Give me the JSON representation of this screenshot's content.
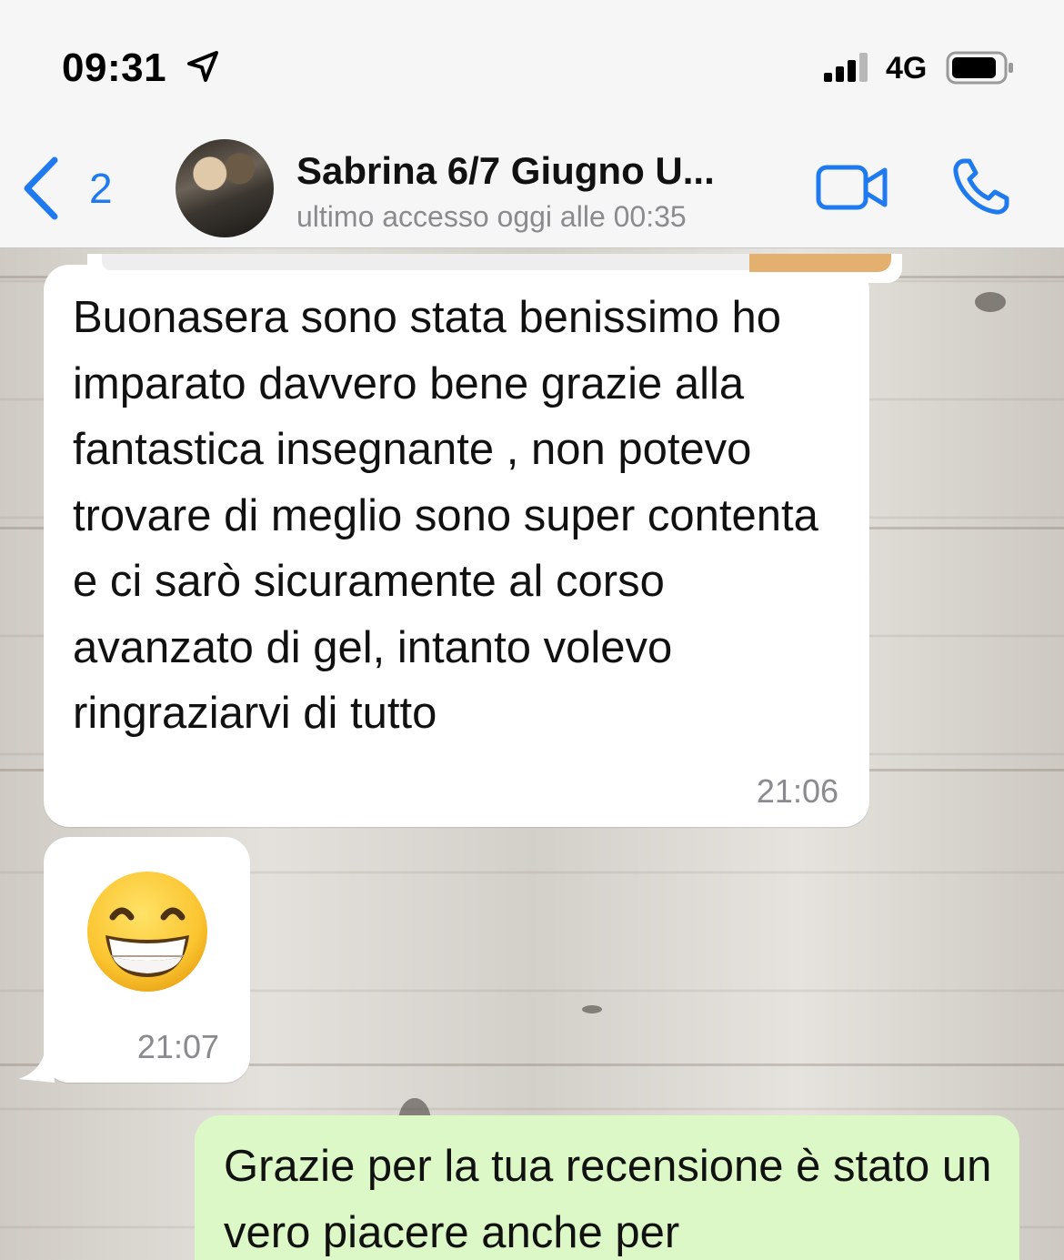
{
  "status_bar": {
    "time": "09:31",
    "network": "4G",
    "icons": [
      "location-arrow-icon",
      "signal-bars-icon",
      "battery-icon"
    ]
  },
  "header": {
    "back_count": "2",
    "contact_name": "Sabrina 6/7 Giugno U...",
    "contact_status": "ultimo accesso oggi alle 00:35",
    "accent_color": "#1f7af0",
    "icons": [
      "chevron-left-icon",
      "video-camera-icon",
      "phone-icon"
    ]
  },
  "messages": [
    {
      "direction": "incoming",
      "text": "Buonasera sono stata benissimo ho imparato davvero bene grazie alla fantastica insegnante , non potevo trovare di meglio sono super contenta e ci sarò sicuramente al corso avanzato di gel, intanto volevo ringraziarvi di tutto",
      "time": "21:06"
    },
    {
      "direction": "incoming",
      "emoji": "😁",
      "emoji_name": "grinning-face-with-smiling-eyes-icon",
      "time": "21:07"
    },
    {
      "direction": "outgoing",
      "text": "Grazie per la tua recensione è stato un vero piacere anche per"
    }
  ],
  "colors": {
    "incoming_bubble": "#ffffff",
    "outgoing_bubble": "#dcf8c6",
    "timestamp": "#8a8a8f"
  }
}
